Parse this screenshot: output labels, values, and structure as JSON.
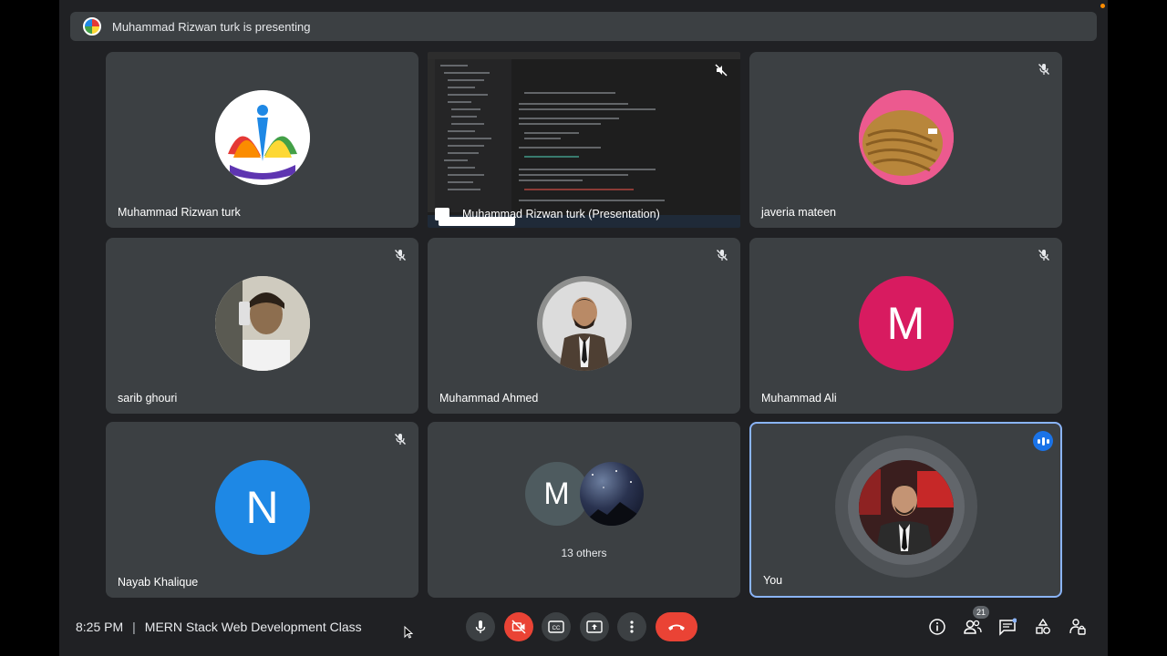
{
  "presenting_banner": "Muhammad Rizwan turk is presenting",
  "tiles": [
    {
      "name": "Muhammad Rizwan turk",
      "muted": false
    },
    {
      "name": "Muhammad Rizwan turk (Presentation)",
      "muted": true
    },
    {
      "name": "javeria mateen",
      "muted": true
    },
    {
      "name": "sarib ghouri",
      "muted": true
    },
    {
      "name": "Muhammad Ahmed",
      "muted": true
    },
    {
      "name": "Muhammad Ali",
      "muted": true,
      "initial": "M",
      "color": "#d81b60"
    },
    {
      "name": "Nayab Khalique",
      "muted": true,
      "initial": "N",
      "color": "#1e88e5"
    },
    {
      "name": "",
      "others_initial": "M",
      "others_label": "13 others"
    },
    {
      "name": "You",
      "speaking": true
    }
  ],
  "meeting": {
    "time": "8:25 PM",
    "separator": "|",
    "title": "MERN Stack Web Development Class"
  },
  "controls": {
    "mic": "microphone-icon",
    "camera": "camera-off-icon",
    "captions": "captions-icon",
    "present": "present-screen-icon",
    "more": "more-options-icon",
    "leave": "leave-call-icon"
  },
  "side_panel": {
    "participants_count": "21"
  },
  "colors": {
    "background": "#202124",
    "tile": "#3c4043",
    "danger": "#ea4335",
    "accent": "#8ab4f8"
  }
}
